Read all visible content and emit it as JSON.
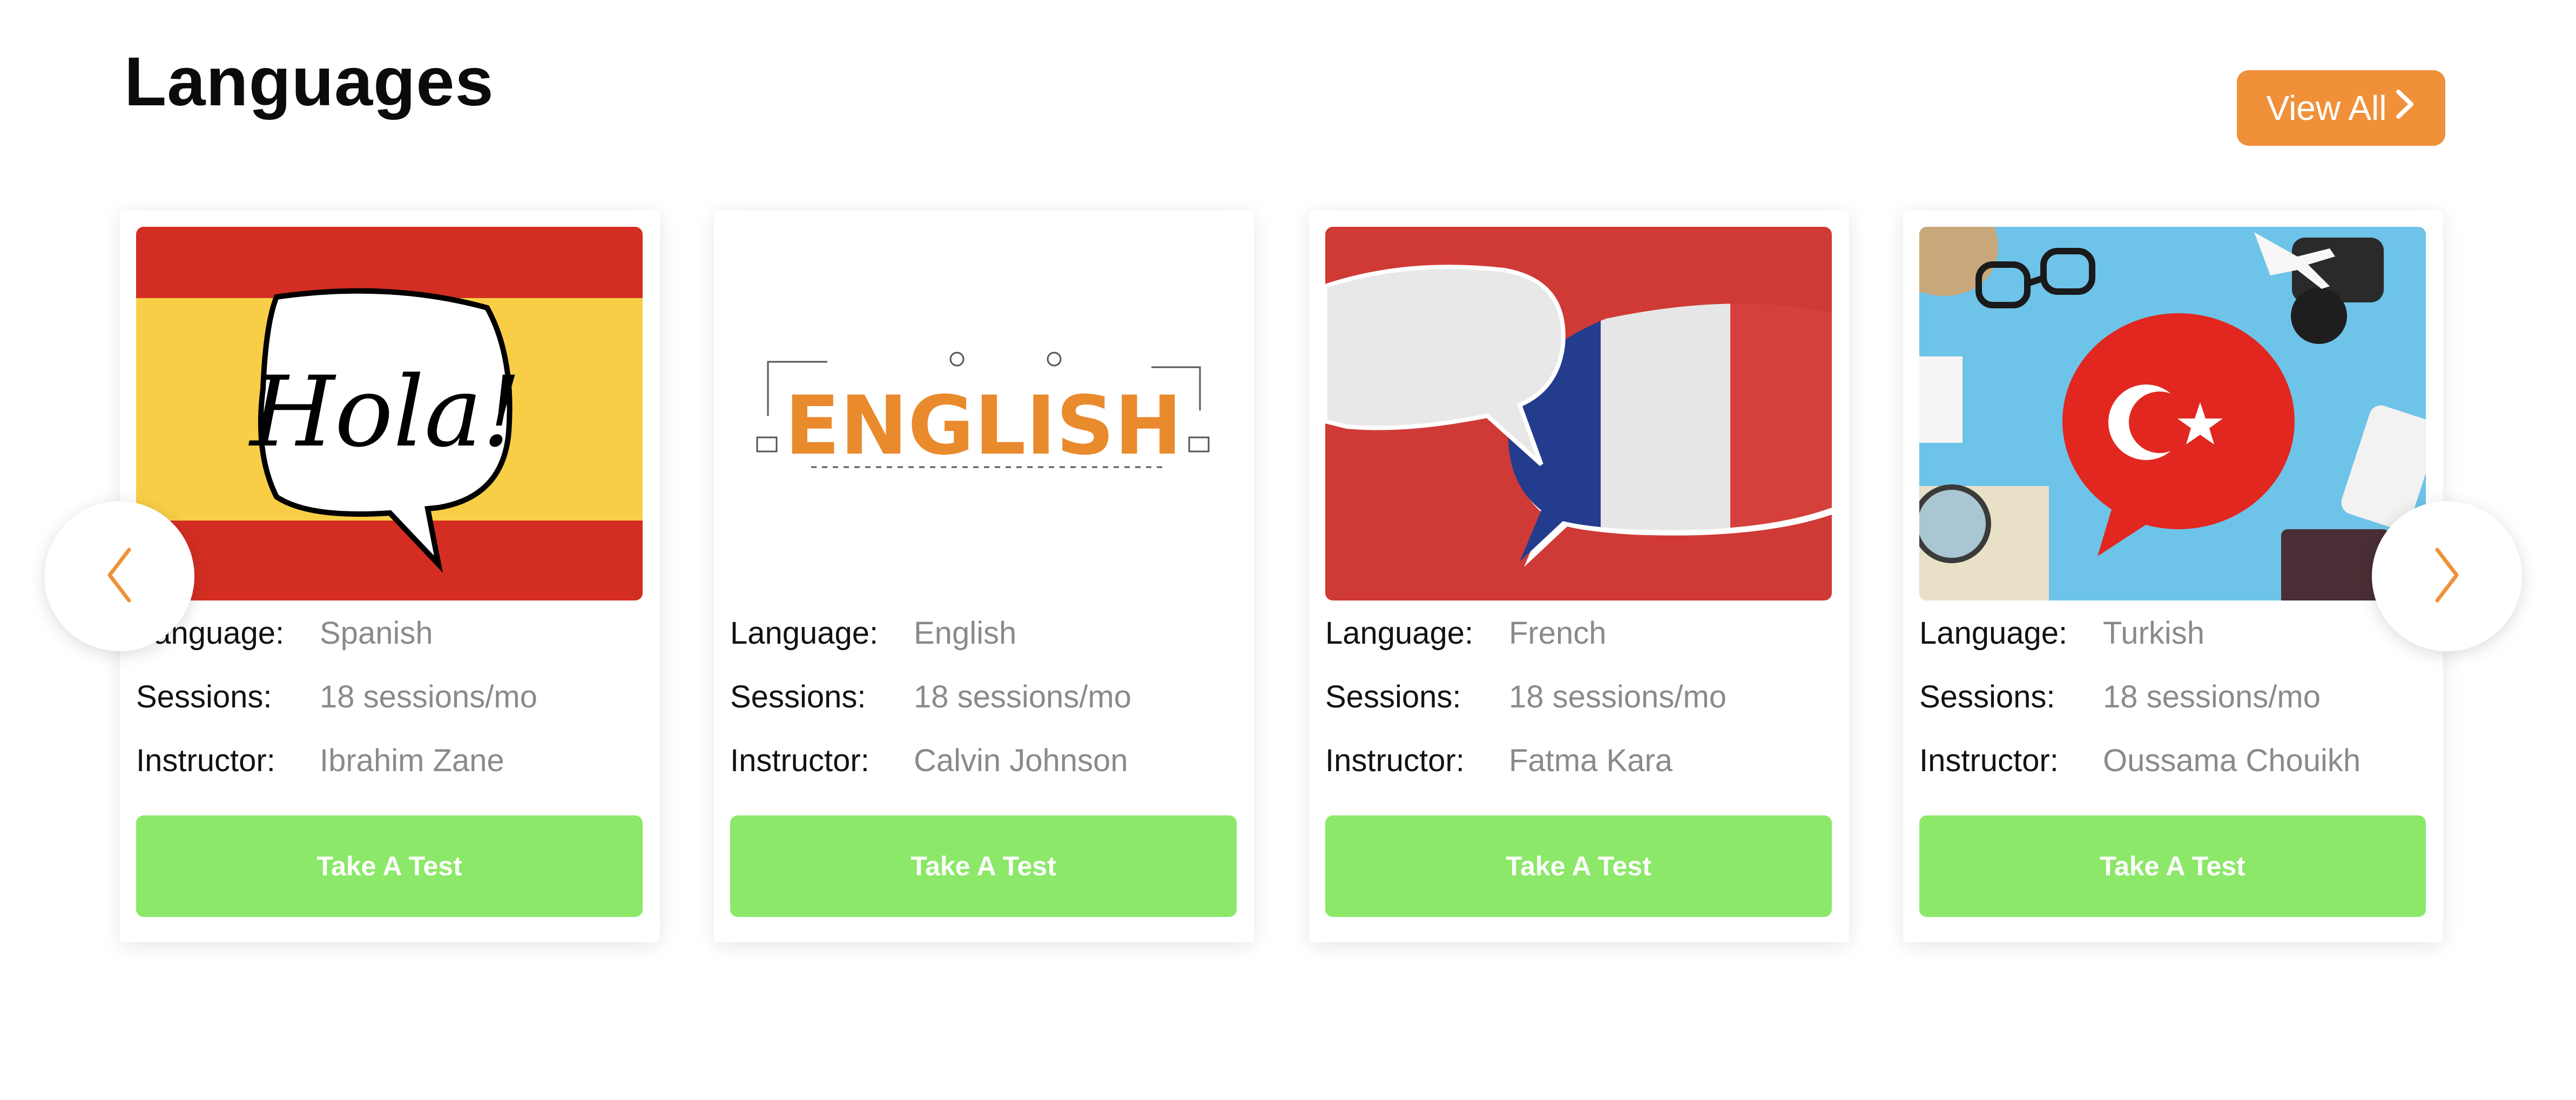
{
  "section": {
    "title": "Languages"
  },
  "view_all": {
    "label": "View All",
    "icon": "chevron-right-icon",
    "color": "#F0913A"
  },
  "colors": {
    "accent": "#F0913A",
    "button_green": "#8BE868",
    "muted_text": "#8A8A8A"
  },
  "labels": {
    "language": "Language:",
    "sessions": "Sessions:",
    "instructor": "Instructor:"
  },
  "cards": [
    {
      "image_text": "Hola!",
      "language": "Spanish",
      "sessions": "18 sessions/mo",
      "instructor": "Ibrahim Zane",
      "button_label": "Take A Test"
    },
    {
      "image_text": "ENGLISH",
      "language": "English",
      "sessions": "18 sessions/mo",
      "instructor": "Calvin Johnson",
      "button_label": "Take A Test"
    },
    {
      "image_text": "",
      "language": "French",
      "sessions": "18 sessions/mo",
      "instructor": "Fatma Kara",
      "button_label": "Take A Test"
    },
    {
      "image_text": "",
      "language": "Turkish",
      "sessions": "18 sessions/mo",
      "instructor": "Oussama Chouikh",
      "button_label": "Take A Test"
    }
  ],
  "carousel": {
    "prev_icon": "chevron-left-icon",
    "next_icon": "chevron-right-icon"
  }
}
